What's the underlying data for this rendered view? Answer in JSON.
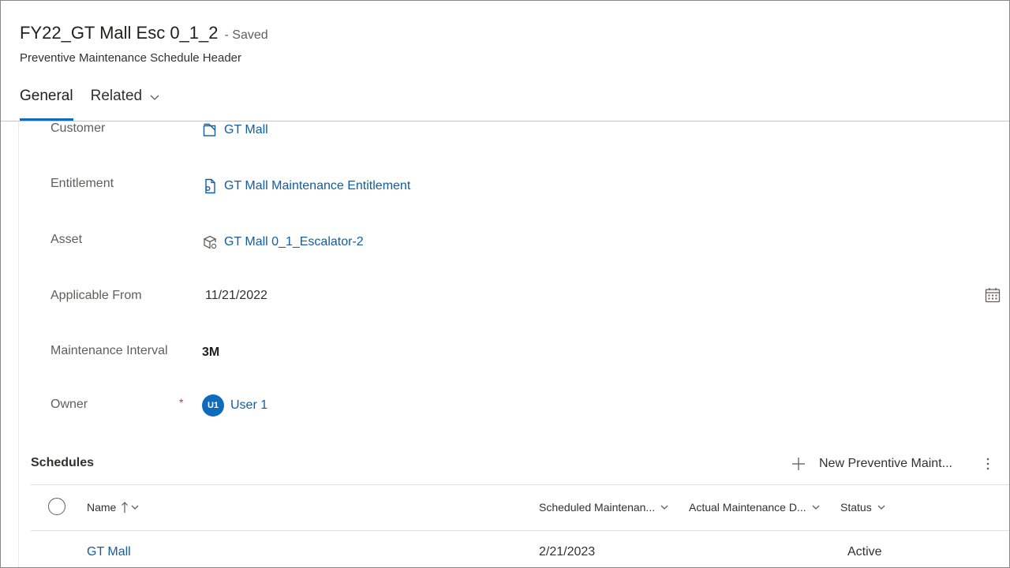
{
  "header": {
    "record_title": "FY22_GT Mall Esc 0_1_2",
    "save_status": "- Saved",
    "entity_name": "Preventive Maintenance Schedule Header",
    "tabs": [
      {
        "label": "General",
        "active": true
      },
      {
        "label": "Related",
        "active": false,
        "icon": "chevron-down-icon"
      }
    ]
  },
  "form": {
    "customer": {
      "label": "Customer",
      "value": "GT Mall",
      "icon": "account-icon"
    },
    "entitlement": {
      "label": "Entitlement",
      "value": "GT Mall Maintenance Entitlement",
      "icon": "document-icon"
    },
    "asset": {
      "label": "Asset",
      "value": "GT Mall 0_1_Escalator-2",
      "icon": "asset-box-icon"
    },
    "applicable_from": {
      "label": "Applicable From",
      "value": "11/21/2022",
      "icon": "calendar-icon"
    },
    "maintenance_interval": {
      "label": "Maintenance Interval",
      "value": "3M"
    },
    "owner": {
      "label": "Owner",
      "required_mark": "*",
      "initials": "U1",
      "value": "User 1"
    }
  },
  "schedules": {
    "title": "Schedules",
    "new_button_label": "New Preventive Maint...",
    "columns": [
      {
        "label": "Name",
        "sort": "ascending"
      },
      {
        "label": "Scheduled Maintenan..."
      },
      {
        "label": "Actual Maintenance D..."
      },
      {
        "label": "Status"
      }
    ],
    "rows": [
      {
        "name": "GT Mall",
        "scheduled": "2/21/2023",
        "actual": "",
        "status": "Active"
      }
    ]
  },
  "colors": {
    "accent": "#0f6cbd",
    "link": "#115ea3",
    "required": "#d13438"
  }
}
